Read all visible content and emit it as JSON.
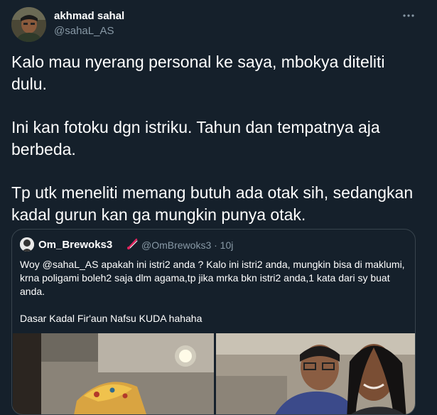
{
  "tweet": {
    "author_name": "akhmad sahal",
    "author_handle": "@sahaL_AS",
    "more_icon": "ellipsis-icon",
    "paragraphs": [
      "Kalo mau nyerang personal ke saya, mbokya diteliti dulu.",
      "Ini kan fotoku dgn istriku. Tahun dan tempatnya aja berbeda.",
      "Tp utk meneliti memang butuh ada otak sih, sedangkan kadal gurun kan ga mungkin punya otak."
    ]
  },
  "quoted": {
    "author_name": "Om_Brewoks3",
    "badge_icon": "brush-icon",
    "handle_time": "@OmBrewoks3 · 10j",
    "paragraphs": [
      "Woy @sahaL_AS apakah ini istri2 anda ? Kalo ini istri2 anda, mungkin bisa di maklumi, krna poligami boleh2 saja dlm agama,tp jika mrka bkn istri2 anda,1 kata dari sy buat anda.",
      "Dasar Kadal Fir'aun Nafsu KUDA hahaha"
    ]
  },
  "colors": {
    "background": "#15202b",
    "text": "#ffffff",
    "secondary": "#8899a6",
    "border": "#38444d"
  }
}
